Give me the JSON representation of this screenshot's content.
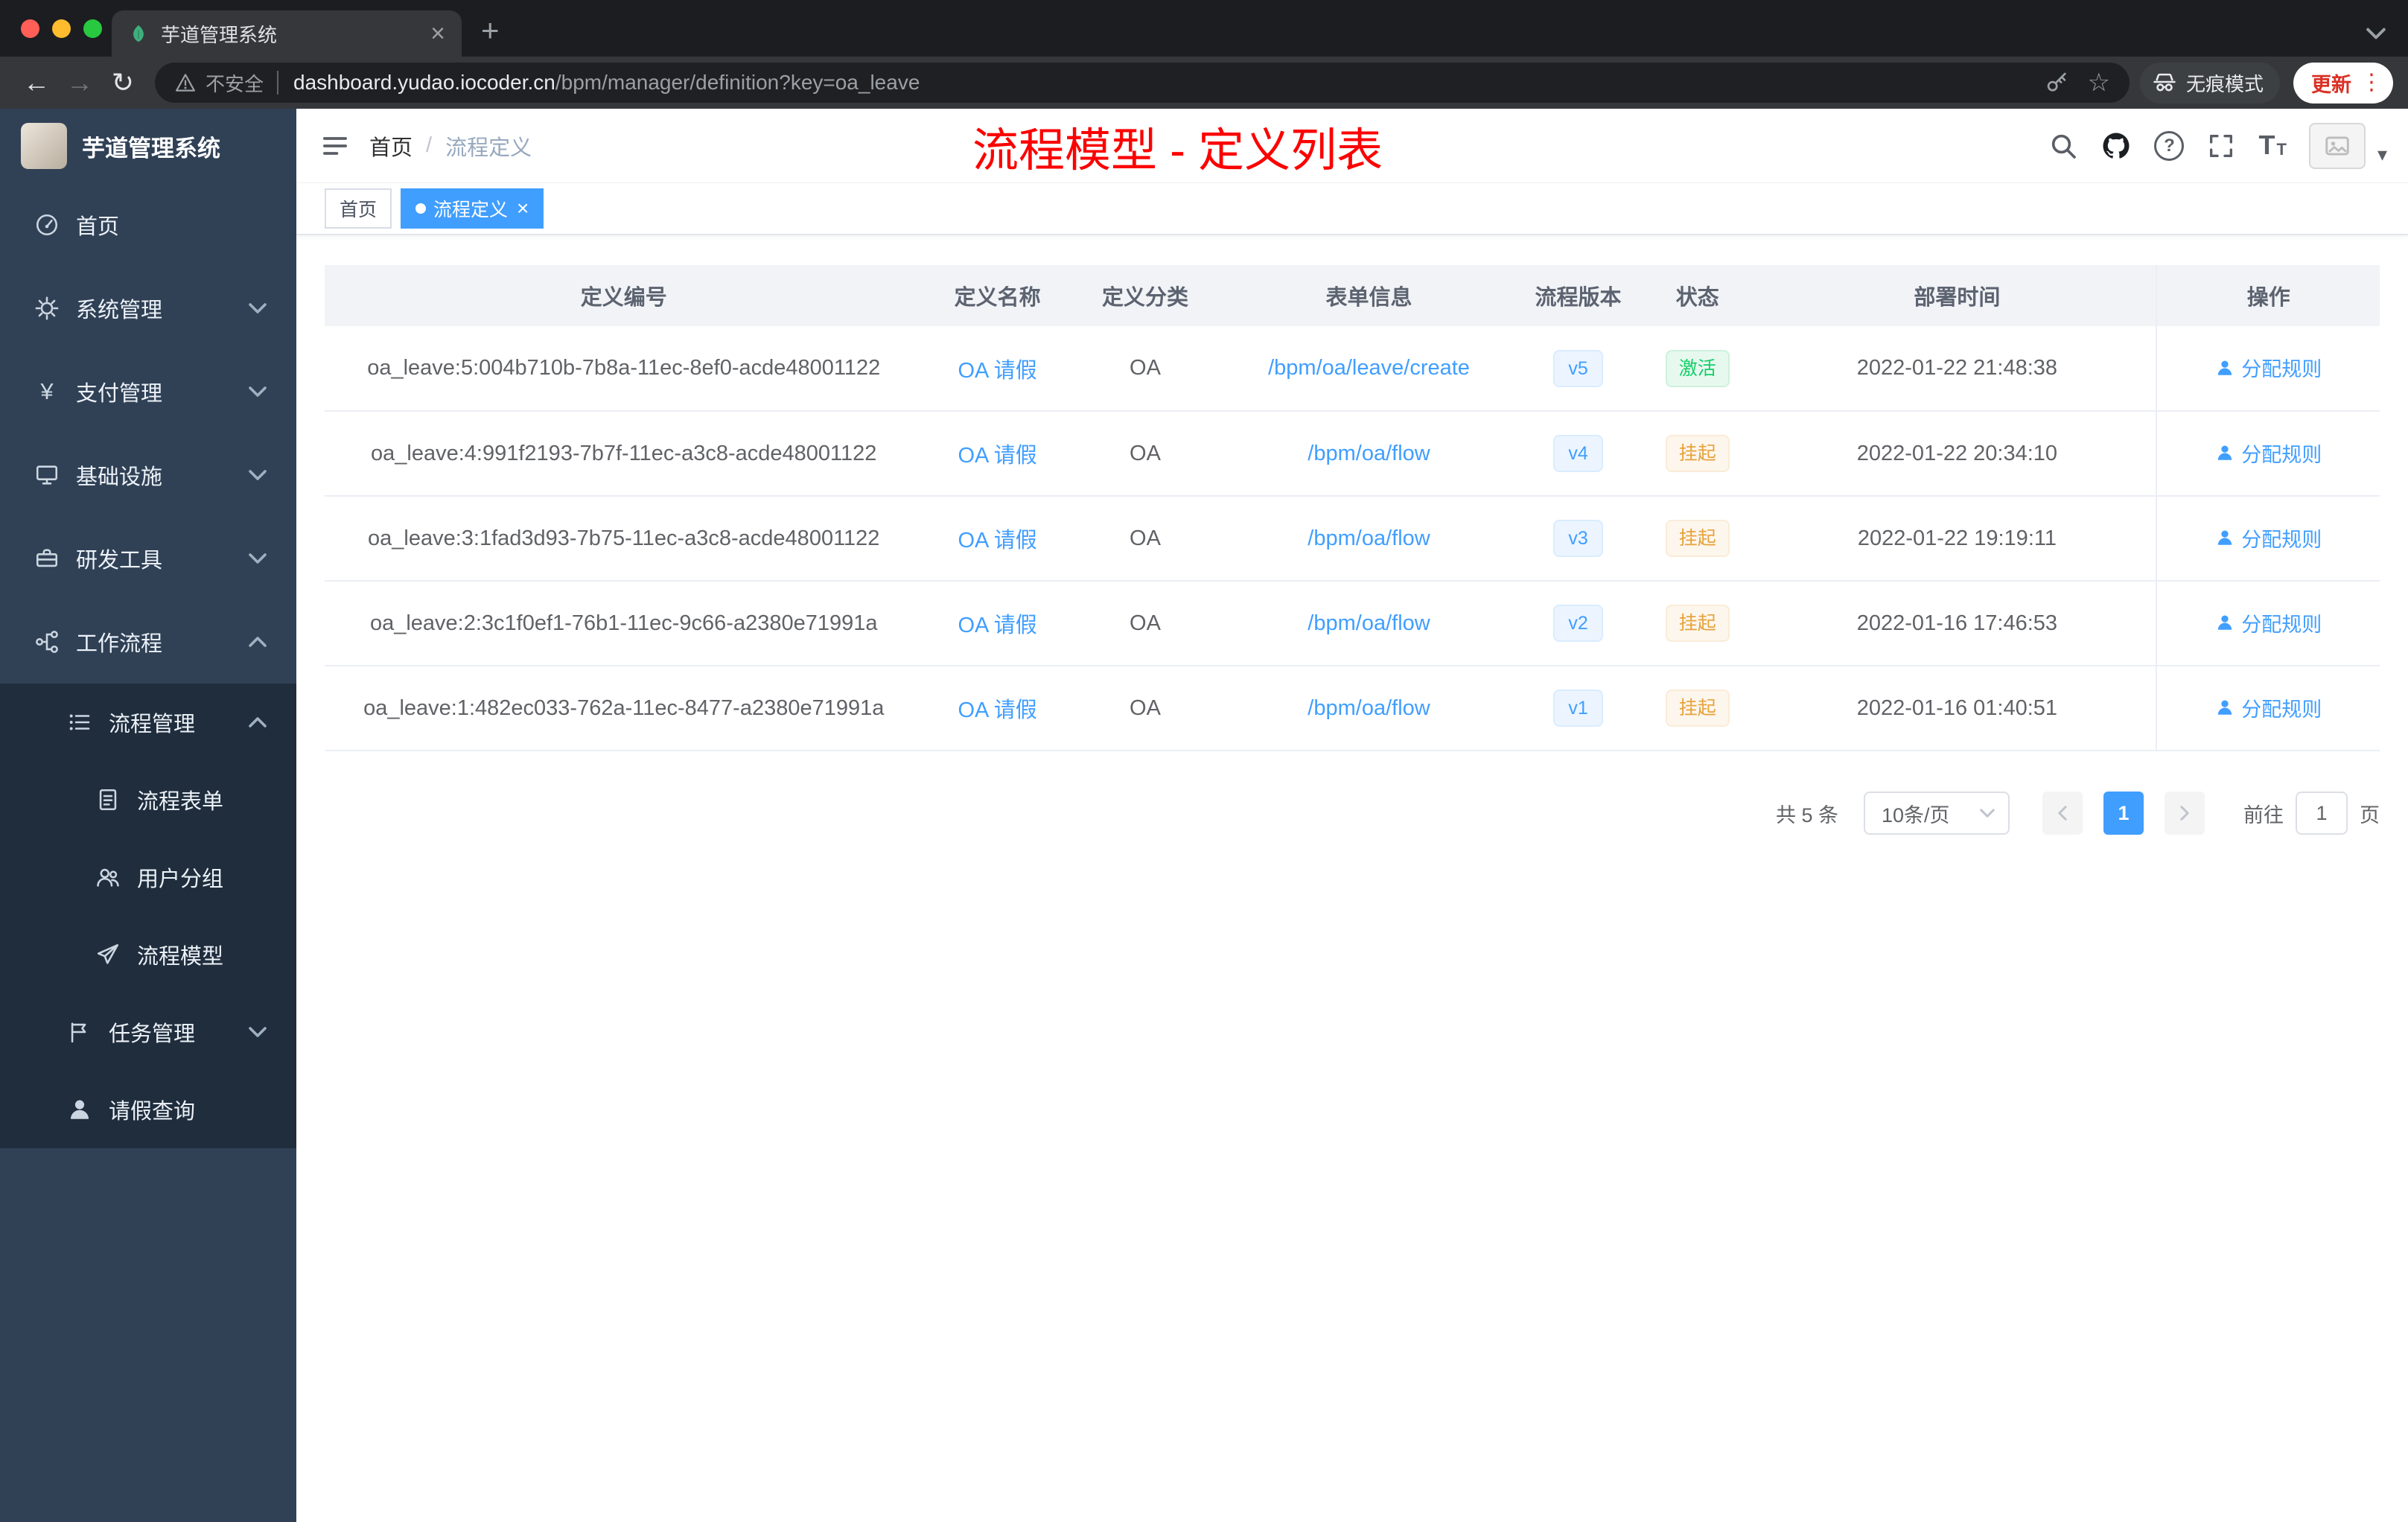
{
  "browser": {
    "tab_title": "芋道管理系统",
    "security_label": "不安全",
    "url_host": "dashboard.yudao.iocoder.cn",
    "url_path": "/bpm/manager/definition?key=oa_leave",
    "incognito_label": "无痕模式",
    "update_label": "更新"
  },
  "icons": {
    "close": "×",
    "new_tab": "+",
    "back": "←",
    "forward": "→",
    "reload": "↻",
    "menu_dots": "⋮",
    "star": "☆",
    "yen": "¥",
    "help": "?",
    "caret": "▾",
    "fontsize": "T",
    "breadcrumb_sep": "/"
  },
  "sidebar": {
    "logo_title": "芋道管理系统",
    "items": [
      {
        "label": "首页"
      },
      {
        "label": "系统管理"
      },
      {
        "label": "支付管理"
      },
      {
        "label": "基础设施"
      },
      {
        "label": "研发工具"
      },
      {
        "label": "工作流程"
      },
      {
        "label": "流程管理"
      },
      {
        "label": "流程表单"
      },
      {
        "label": "用户分组"
      },
      {
        "label": "流程模型"
      },
      {
        "label": "任务管理"
      },
      {
        "label": "请假查询"
      }
    ]
  },
  "header": {
    "breadcrumb_home": "首页",
    "breadcrumb_current": "流程定义",
    "annotation": "流程模型 - 定义列表"
  },
  "tags": {
    "home": "首页",
    "current": "流程定义"
  },
  "table": {
    "columns": [
      "定义编号",
      "定义名称",
      "定义分类",
      "表单信息",
      "流程版本",
      "状态",
      "部署时间",
      "操作"
    ],
    "rows": [
      {
        "id": "oa_leave:5:004b710b-7b8a-11ec-8ef0-acde48001122",
        "name": "OA 请假",
        "category": "OA",
        "form": "/bpm/oa/leave/create",
        "version": "v5",
        "status": "激活",
        "status_type": "success",
        "time": "2022-01-22 21:48:38",
        "action": "分配规则"
      },
      {
        "id": "oa_leave:4:991f2193-7b7f-11ec-a3c8-acde48001122",
        "name": "OA 请假",
        "category": "OA",
        "form": "/bpm/oa/flow",
        "version": "v4",
        "status": "挂起",
        "status_type": "warning",
        "time": "2022-01-22 20:34:10",
        "action": "分配规则"
      },
      {
        "id": "oa_leave:3:1fad3d93-7b75-11ec-a3c8-acde48001122",
        "name": "OA 请假",
        "category": "OA",
        "form": "/bpm/oa/flow",
        "version": "v3",
        "status": "挂起",
        "status_type": "warning",
        "time": "2022-01-22 19:19:11",
        "action": "分配规则"
      },
      {
        "id": "oa_leave:2:3c1f0ef1-76b1-11ec-9c66-a2380e71991a",
        "name": "OA 请假",
        "category": "OA",
        "form": "/bpm/oa/flow",
        "version": "v2",
        "status": "挂起",
        "status_type": "warning",
        "time": "2022-01-16 17:46:53",
        "action": "分配规则"
      },
      {
        "id": "oa_leave:1:482ec033-762a-11ec-8477-a2380e71991a",
        "name": "OA 请假",
        "category": "OA",
        "form": "/bpm/oa/flow",
        "version": "v1",
        "status": "挂起",
        "status_type": "warning",
        "time": "2022-01-16 01:40:51",
        "action": "分配规则"
      }
    ]
  },
  "pagination": {
    "total": "共 5 条",
    "page_size": "10条/页",
    "current_page": "1",
    "goto_label": "前往",
    "goto_value": "1",
    "page_unit": "页"
  },
  "colors": {
    "accent": "#409eff",
    "annotation_red": "#fb0200",
    "success": "#13ce66",
    "warning": "#e6a23c",
    "sidebar_bg": "#304156",
    "submenu_bg": "#1f2d3d"
  }
}
